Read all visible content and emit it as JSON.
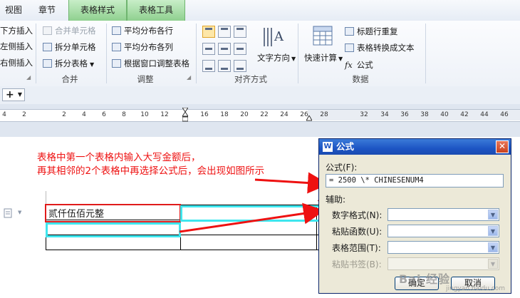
{
  "tabs": [
    {
      "label": "视图",
      "active": false
    },
    {
      "label": "章节",
      "active": false
    },
    {
      "label": "表格样式",
      "active": true
    },
    {
      "label": "表格工具",
      "active": true
    }
  ],
  "ribbon": {
    "insert_items": [
      "下方插入",
      "左侧插入",
      "右侧插入"
    ],
    "merge": {
      "items": [
        "合并单元格",
        "拆分单元格",
        "拆分表格"
      ],
      "label": "合并"
    },
    "adjust": {
      "items": [
        "平均分布各行",
        "平均分布各列",
        "根据窗口调整表格"
      ],
      "label": "调整"
    },
    "align": {
      "label": "对齐方式",
      "text_direction": "文字方向"
    },
    "data": {
      "quick_calc": "快速计算",
      "items": [
        "标题行重复",
        "表格转换成文本",
        "公式"
      ],
      "label": "数据"
    }
  },
  "ruler": {
    "left_labels": [
      "4",
      "2"
    ],
    "labels": [
      "2",
      "4",
      "6",
      "8",
      "10",
      "12",
      "16",
      "18",
      "20",
      "22",
      "24",
      "26",
      "28",
      "32",
      "34",
      "36",
      "38",
      "40",
      "42",
      "44",
      "46"
    ]
  },
  "annotation": {
    "line1": "表格中第一个表格内输入大写金额后，",
    "line2": "再其相邻的2个表格中再选择公式后，会出现如图所示"
  },
  "table": {
    "rows": [
      [
        "贰仟伍佰元整",
        "",
        ""
      ],
      [
        "",
        "",
        ""
      ],
      [
        "",
        "",
        ""
      ]
    ]
  },
  "dialog": {
    "icon": "W",
    "title": "公式",
    "formula_label": "公式(F):",
    "formula_value": "= 2500 \\* CHINESENUM4",
    "assist_label": "辅助:",
    "number_format_label": "数字格式(N):",
    "paste_function_label": "粘贴函数(U):",
    "table_range_label": "表格范围(T):",
    "paste_bookmark_label": "粘贴书签(B):",
    "ok_label": "确定",
    "cancel_label": "取消"
  },
  "watermark": {
    "text": "Bai 经验",
    "sub": "jingyan.baidu.com"
  },
  "colors": {
    "tab_green": "#8fd08f",
    "annotation_red": "#e11111",
    "highlight_cyan": "#3ee6ee",
    "highlight_red": "#e01b1b",
    "dialog_title_blue": "#1d55c4",
    "dialog_bg": "#ece9d8"
  }
}
